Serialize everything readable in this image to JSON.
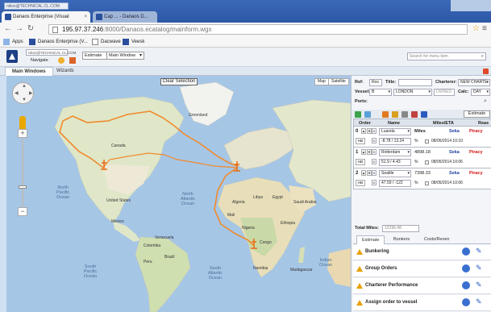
{
  "browser": {
    "profile": "nikos@TECHNICAL.CL.COM",
    "tabs": [
      {
        "title": "Danaos Enterprise (Visual"
      },
      {
        "title": "Cap ... - Danaos D..."
      }
    ],
    "url_host": "195.97.37.246",
    "url_path": ":8000/Danaos.ecatalog/mainform.wgx",
    "bookmarks": [
      {
        "label": "Apps"
      },
      {
        "label": "Danaos Enterprise (V..."
      },
      {
        "label": "Dacwave"
      },
      {
        "label": "Veesk"
      }
    ]
  },
  "app": {
    "user": "nikos@TECHNICAL.CL.COM",
    "navigate_label": "Navigate",
    "estimate_select": "Estimate",
    "window_select": "Main Window",
    "search_placeholder": "Search for menu item",
    "tabs": [
      {
        "label": "Main Windows"
      },
      {
        "label": "Wizards"
      }
    ]
  },
  "map": {
    "map_type_buttons": [
      "Map",
      "Satellite"
    ],
    "clear_selection": "Clear Selection",
    "labels": {
      "greenland": "Greenland",
      "north_pacific": "North\nPacific\nOcean",
      "north_atlantic": "North\nAtlantic\nOcean",
      "south_pacific": "South\nPacific\nOcean",
      "south_atlantic": "South\nAtlantic\nOcean",
      "indian": "Indian\nOcean",
      "brazil": "Brazil",
      "peru": "Peru",
      "nigeria": "Nigeria",
      "ethiopia": "Ethiopia",
      "algeria": "Algeria",
      "libya": "Libya",
      "egypt": "Egypt",
      "mali": "Mali",
      "namibia": "Namibia",
      "mexico": "Mexico",
      "united_states": "United States",
      "canada": "Canada",
      "saudi_arabia": "Saudi Arabia",
      "colombia": "Colombia",
      "venezuela": "Venezuela",
      "congo": "Congo",
      "madagascar": "Madagascar"
    },
    "route_color": "#f08a2c"
  },
  "panel": {
    "ref_label": "Ref:",
    "ref_value": "Ros",
    "title_label": "Title:",
    "title_value": "",
    "charterer_label": "Charterer:",
    "charterer_value": "NEW CHARTE",
    "vessel_label": "Vessel:",
    "vessel_value": "B",
    "port_value": "LONDON",
    "owned_value": "OWNED",
    "calc_label": "Calc:",
    "calc_value": "DAY",
    "ports_label": "Ports:",
    "estimate_button": "Estimate",
    "grid_headers": [
      "Order",
      "Name",
      "Miles/ETA",
      "Reas"
    ],
    "rows": [
      {
        "num": "0",
        "port": "Luanda",
        "coord": "-8.78 / 13.24",
        "miles_label": "Miles",
        "miles": "",
        "pct": "%",
        "date": "08/05/2014",
        "time": "10:10",
        "seka": "Seka",
        "piracy": "Piracy"
      },
      {
        "num": "1",
        "port": "Rotterdam",
        "coord": "51.9 / 4.43",
        "miles_label": "",
        "miles": "4898.18",
        "pct": "%",
        "date": "08/05/2014",
        "time": "10:06",
        "seka": "Seka",
        "piracy": "Piracy"
      },
      {
        "num": "2",
        "port": "Seattle",
        "coord": "47.59 / -122",
        "miles_label": "",
        "miles": "7398.33",
        "pct": "%",
        "date": "08/05/2014",
        "time": "10:06",
        "seka": "Seka",
        "piracy": "Piracy"
      }
    ],
    "hb_label": "HB",
    "total_miles_label": "Total Miles:",
    "total_miles_value": "12296.48",
    "bottom_tabs": [
      "Estimate",
      "Bunkers",
      "Costs/Reven"
    ],
    "actions": [
      {
        "label": "Bunkering"
      },
      {
        "label": "Group Orders"
      },
      {
        "label": "Charterer Performance"
      },
      {
        "label": "Assign order to vessel"
      }
    ]
  }
}
